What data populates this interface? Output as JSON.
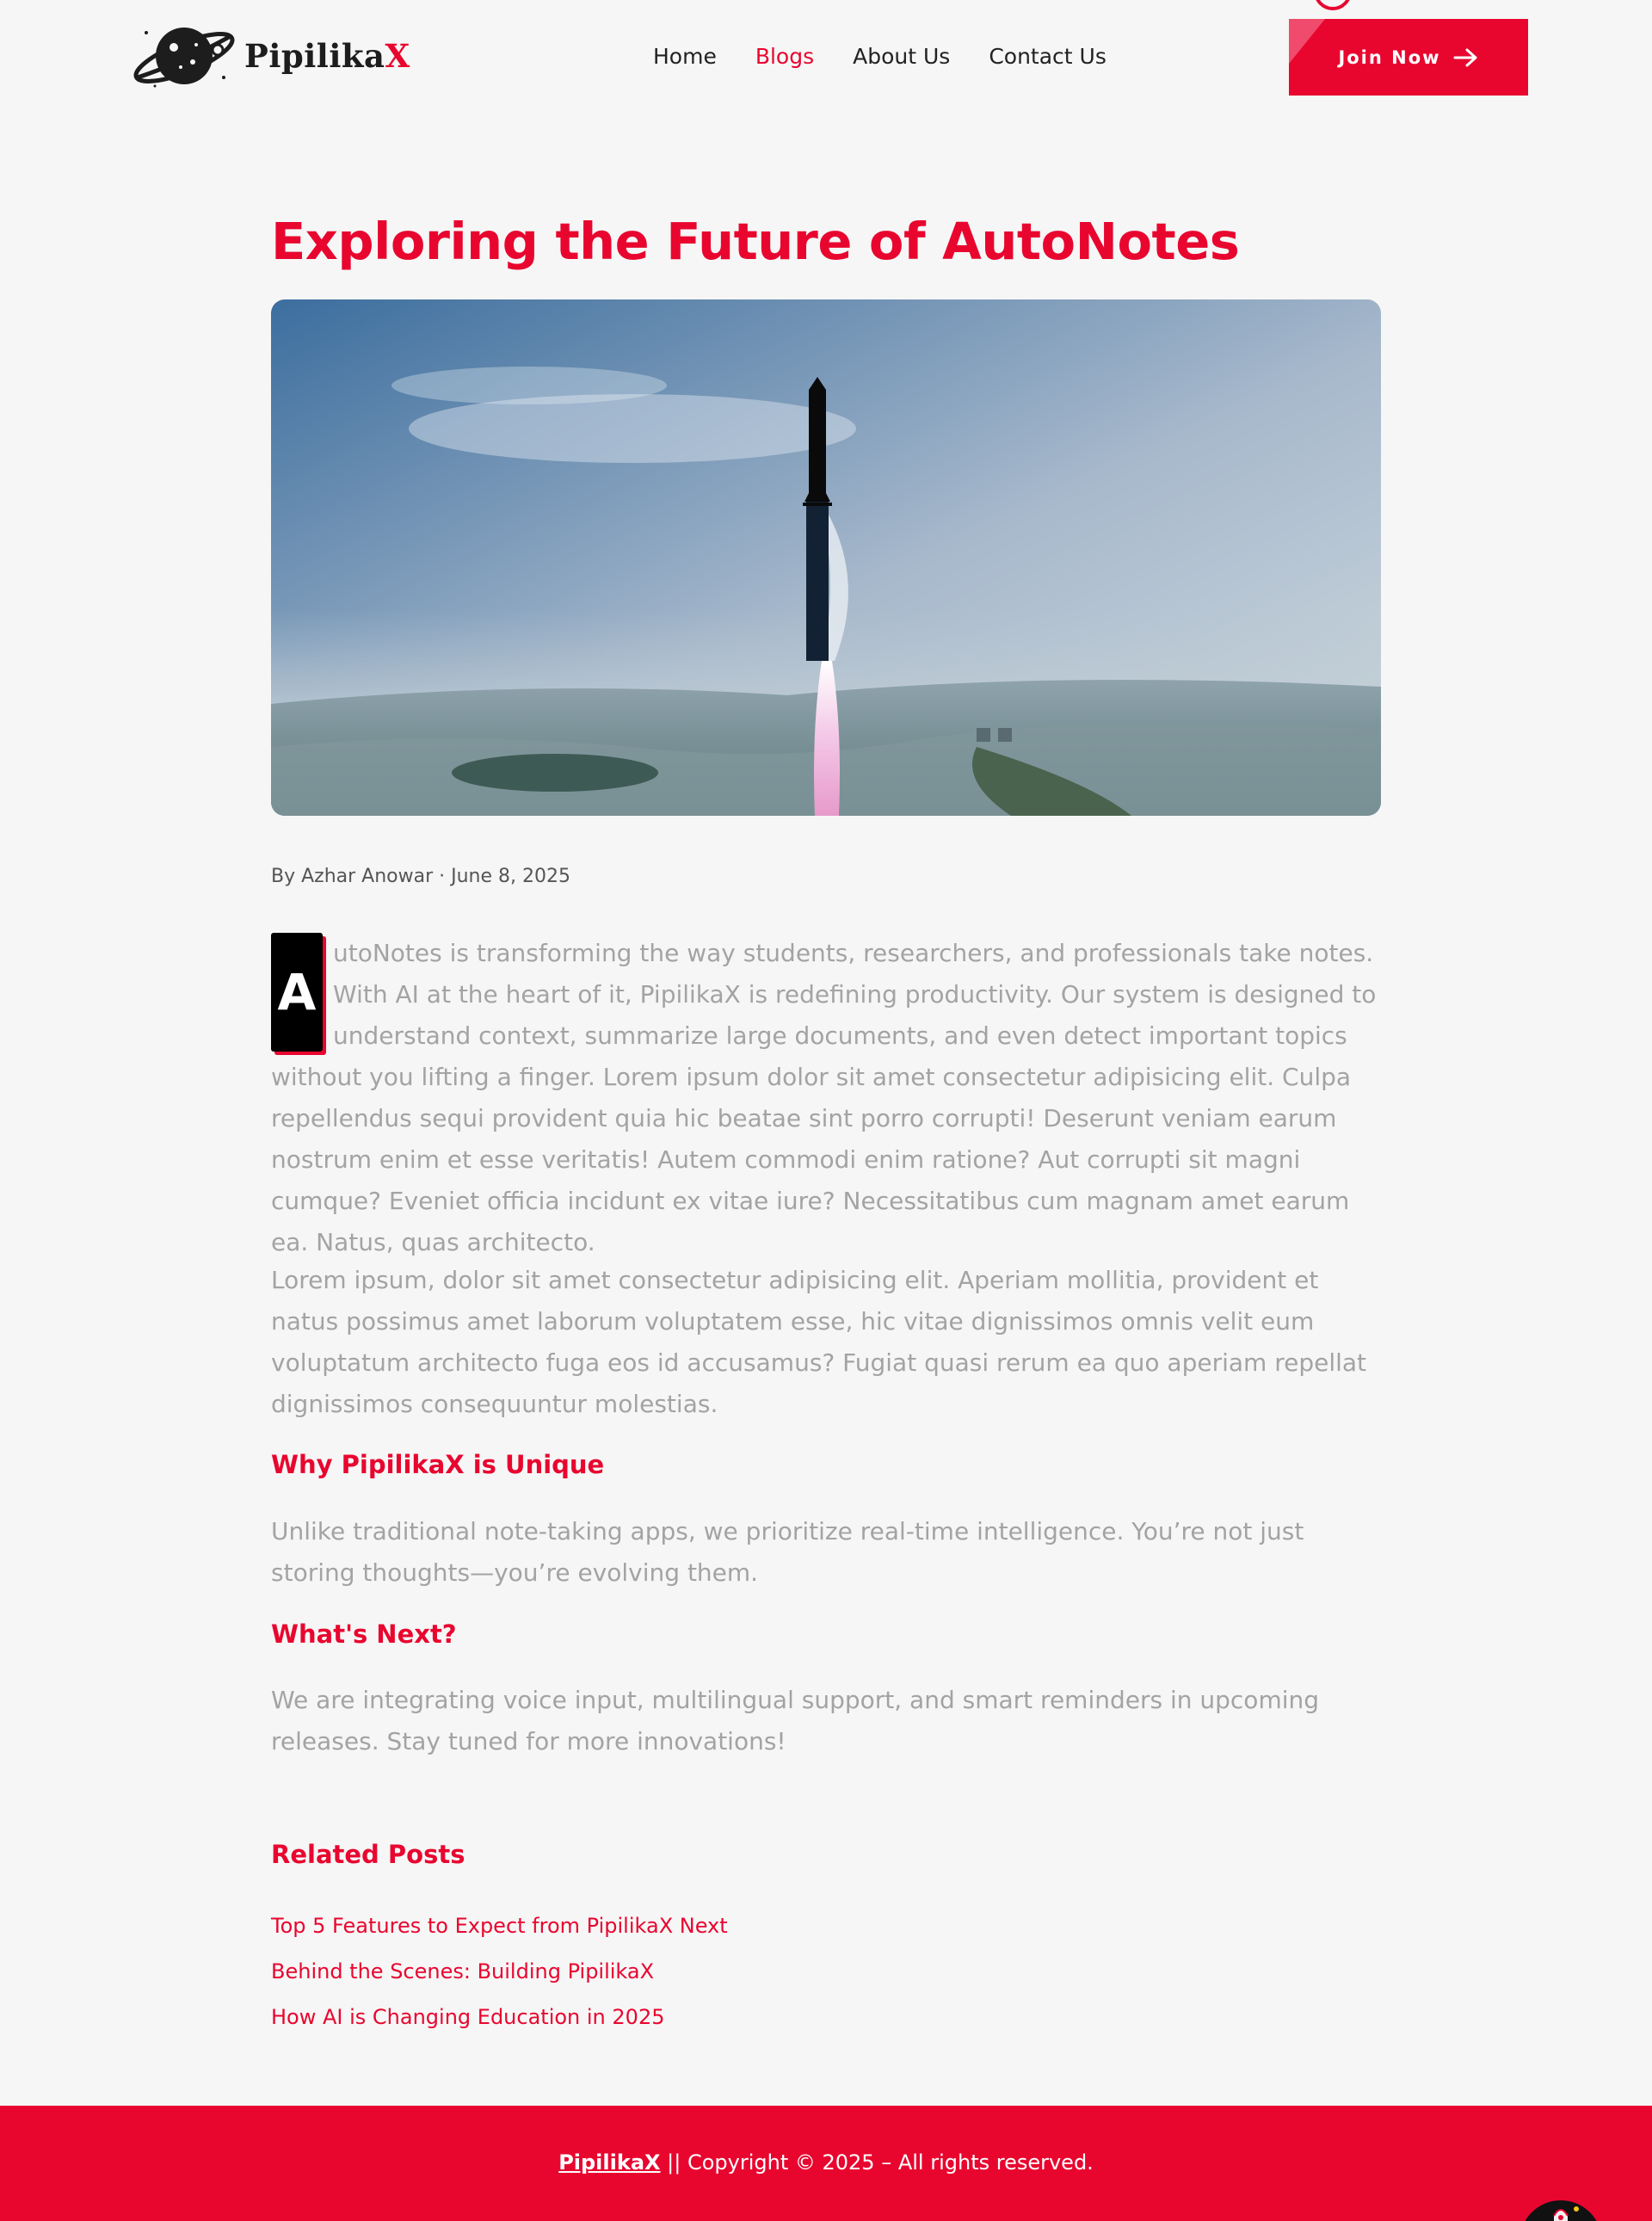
{
  "header": {
    "logo": {
      "text_main": "Pipilika",
      "text_accent": "X"
    },
    "nav": [
      {
        "label": "Home",
        "active": false
      },
      {
        "label": "Blogs",
        "active": true
      },
      {
        "label": "About Us",
        "active": false
      },
      {
        "label": "Contact Us",
        "active": false
      }
    ],
    "cta_label": "Join Now"
  },
  "article": {
    "title": "Exploring the Future of AutoNotes",
    "meta": "By Azhar Anowar · June 8, 2025",
    "dropcap": "A",
    "paragraph1": "utoNotes is transforming the way students, researchers, and professionals take notes. With AI at the heart of it, PipilikaX is redefining productivity. Our system is designed to understand context, summarize large documents, and even detect important topics without you lifting a finger. Lorem ipsum dolor sit amet consectetur adipisicing elit. Culpa repellendus sequi provident quia hic beatae sint porro corrupti! Deserunt veniam earum nostrum enim et esse veritatis! Autem commodi enim ratione? Aut corrupti sit magni cumque? Eveniet officia incidunt ex vitae iure? Necessitatibus cum magnam amet earum ea. Natus, quas architecto.",
    "paragraph2": "Lorem ipsum, dolor sit amet consectetur adipisicing elit. Aperiam mollitia, provident et natus possimus amet laborum voluptatem esse, hic vitae dignissimos omnis velit eum voluptatum architecto fuga eos id accusamus? Fugiat quasi rerum ea quo aperiam repellat dignissimos consequuntur molestias.",
    "heading_unique": "Why PipilikaX is Unique",
    "paragraph3": "Unlike traditional note-taking apps, we prioritize real-time intelligence. You’re not just storing thoughts—you’re evolving them.",
    "heading_next": "What's Next?",
    "paragraph4": "We are integrating voice input, multilingual support, and smart reminders in upcoming releases. Stay tuned for more innovations!"
  },
  "related": {
    "title": "Related Posts",
    "links": [
      "Top 5 Features to Expect from PipilikaX Next",
      "Behind the Scenes: Building PipilikaX",
      "How AI is Changing Education in 2025"
    ]
  },
  "footer": {
    "brand": "PipilikaX",
    "text": " || Copyright © 2025 – All rights reserved."
  },
  "colors": {
    "accent": "#e8062f",
    "background": "#f6f6f6",
    "body_text": "#a3a3a3"
  },
  "icons": {
    "cta": "arrow-right-icon",
    "scroll_button": "rocket-icon",
    "logo": "planet-emblem-icon"
  }
}
